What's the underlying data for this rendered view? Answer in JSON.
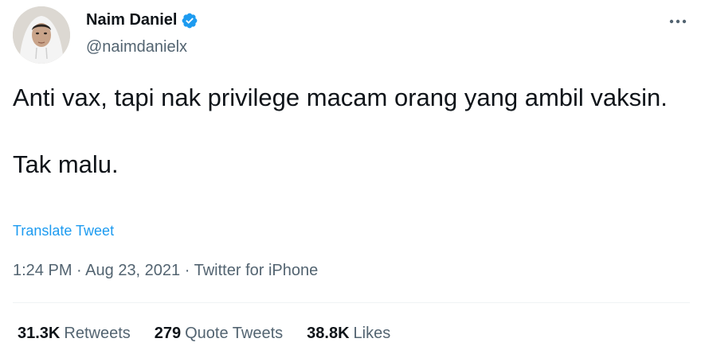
{
  "author": {
    "display_name": "Naim Daniel",
    "handle": "@naimdanielx",
    "verified": true
  },
  "tweet": {
    "lines": [
      "Anti vax, tapi nak privilege macam orang yang ambil vaksin.",
      "Tak malu."
    ],
    "translate_label": "Translate Tweet",
    "time": "1:24 PM",
    "date": "Aug 23, 2021",
    "source": "Twitter for iPhone",
    "separator": "·"
  },
  "stats": {
    "retweets_count": "31.3K",
    "retweets_label": "Retweets",
    "quotes_count": "279",
    "quotes_label": "Quote Tweets",
    "likes_count": "38.8K",
    "likes_label": "Likes"
  },
  "colors": {
    "accent": "#1d9bf0",
    "text": "#0f1419",
    "secondary": "#536471"
  },
  "icons": {
    "verified": "verified-badge-icon",
    "more": "more-options-icon"
  }
}
